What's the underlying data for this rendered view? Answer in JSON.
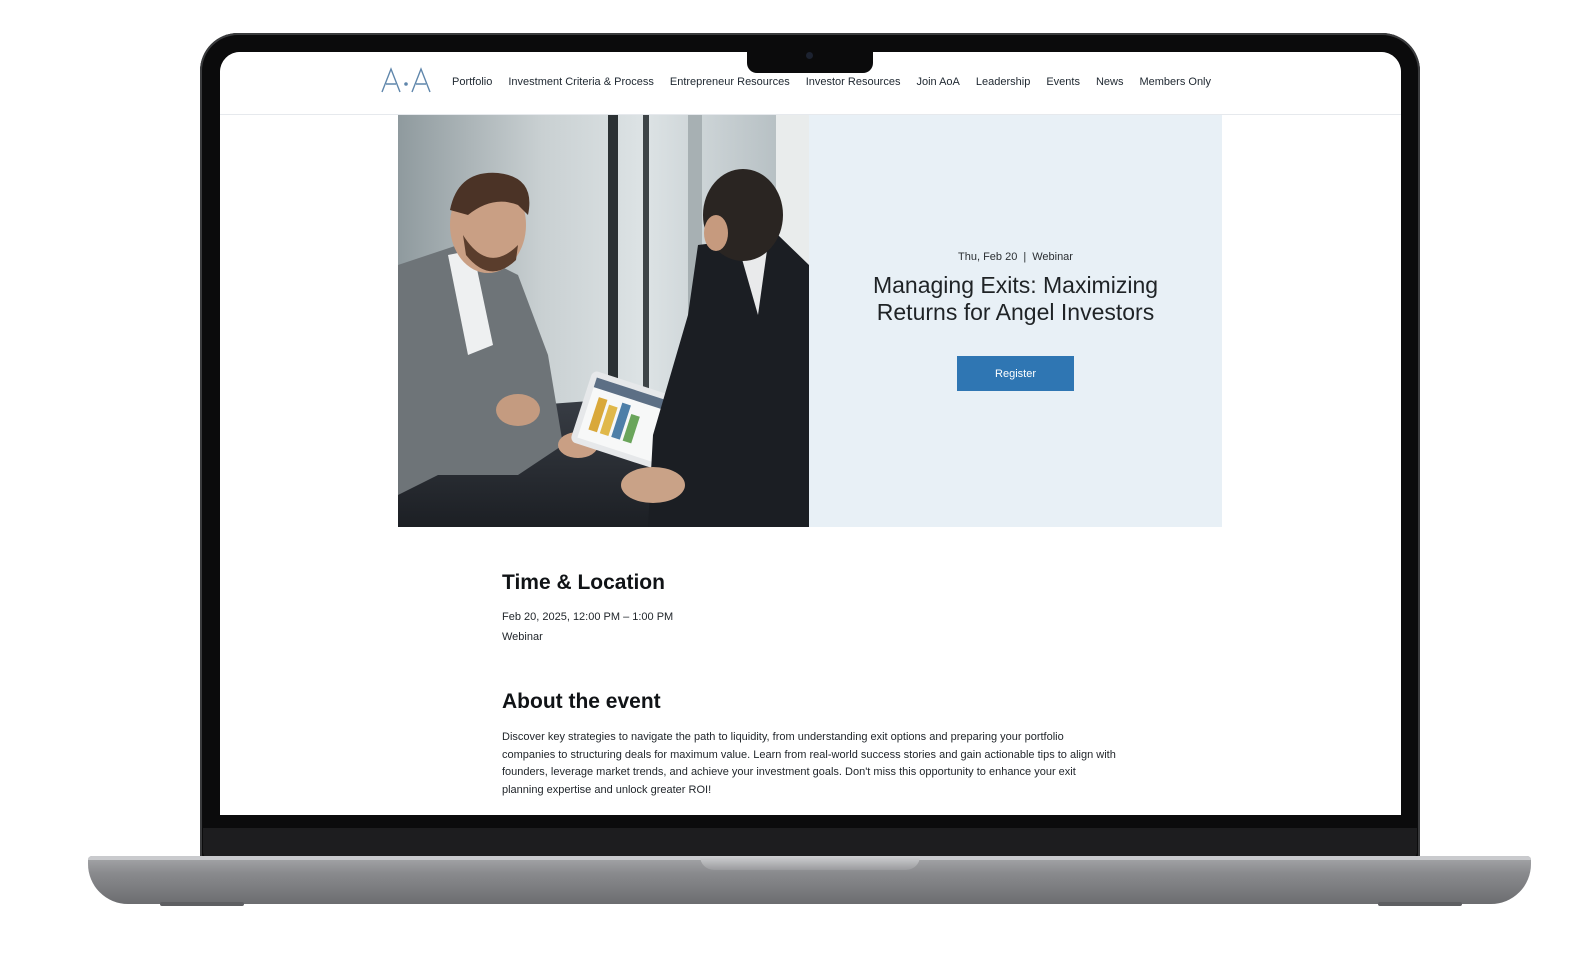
{
  "site": {
    "logo_text": "A·A",
    "nav": [
      "Portfolio",
      "Investment Criteria & Process",
      "Entrepreneur Resources",
      "Investor Resources",
      "Join AoA",
      "Leadership",
      "Events",
      "News",
      "Members Only"
    ]
  },
  "hero": {
    "date": "Thu, Feb 20",
    "separator": "|",
    "format": "Webinar",
    "title": "Managing Exits: Maximizing Returns for Angel Investors",
    "register_label": "Register",
    "accent_color": "#2f76b3",
    "panel_color": "#e8f0f6"
  },
  "time_location": {
    "heading": "Time & Location",
    "datetime": "Feb 20, 2025, 12:00 PM – 1:00 PM",
    "location": "Webinar"
  },
  "about": {
    "heading": "About the event",
    "body": "Discover key strategies to navigate the path to liquidity, from understanding exit options and preparing your portfolio companies to structuring deals for maximum value. Learn from real-world success stories and gain actionable tips to align with founders, leverage market trends, and achieve your investment goals. Don't miss this opportunity to enhance your exit planning expertise and unlock greater ROI!"
  }
}
